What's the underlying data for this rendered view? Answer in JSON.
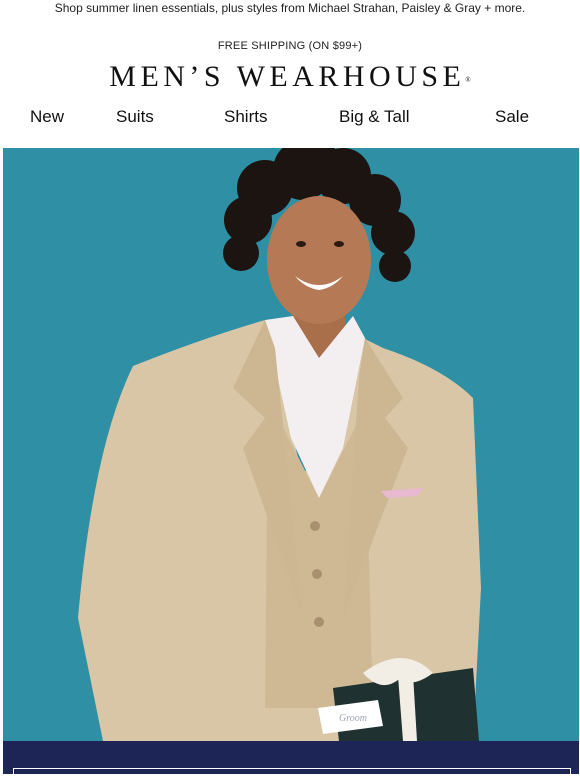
{
  "preheader": "Shop summer linen essentials, plus styles from Michael Strahan, Paisley & Gray + more.",
  "shipping": "FREE SHIPPING (ON $99+)",
  "logo": {
    "text": "MEN’S WEARHOUSE",
    "mark": "®"
  },
  "nav": [
    {
      "label": "New"
    },
    {
      "label": "Suits"
    },
    {
      "label": "Shirts"
    },
    {
      "label": "Big & Tall"
    },
    {
      "label": "Sale"
    }
  ],
  "hero": {
    "background": "#2f8fa5",
    "suit_color": "#d9c6a6",
    "shirt_color": "#f3eef0",
    "skin_color": "#b57a55",
    "hair_color": "#1c1410",
    "gift_box_color": "#1f3130",
    "ribbon_color": "#f2eee6",
    "tag_text": "Groom"
  },
  "banner": {
    "background": "#1d2556"
  }
}
